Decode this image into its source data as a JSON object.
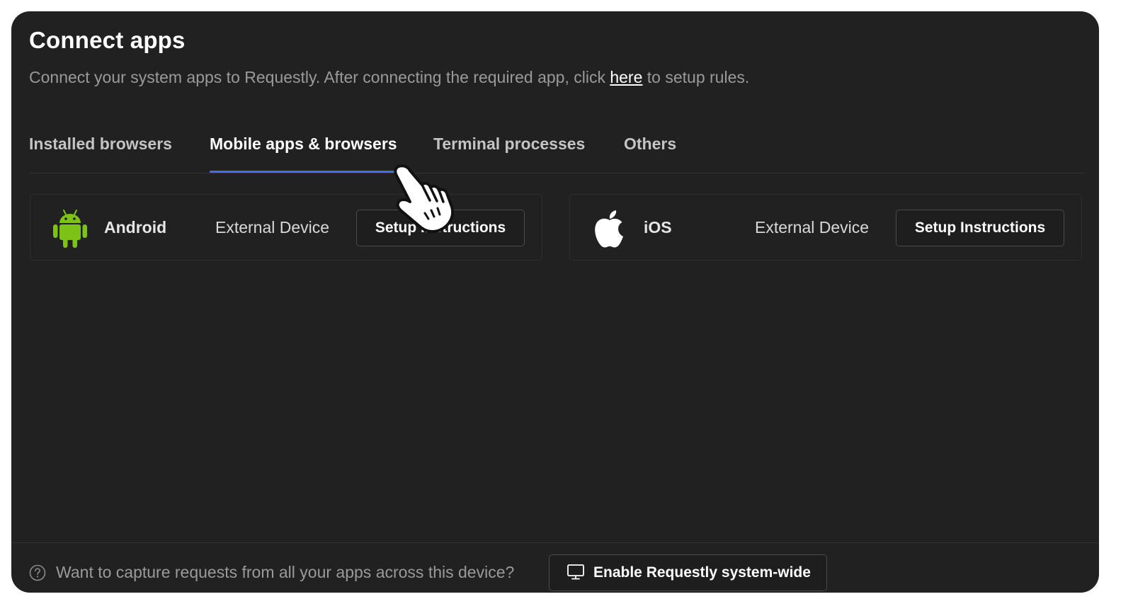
{
  "header": {
    "title": "Connect apps",
    "subtitle_before": "Connect your system apps to Requestly. After connecting the required app, click ",
    "subtitle_link": "here",
    "subtitle_after": " to setup rules."
  },
  "tabs": [
    {
      "label": "Installed browsers",
      "active": false
    },
    {
      "label": "Mobile apps & browsers",
      "active": true
    },
    {
      "label": "Terminal processes",
      "active": false
    },
    {
      "label": "Others",
      "active": false
    }
  ],
  "cards": [
    {
      "name": "Android",
      "device": "External Device",
      "button": "Setup Instructions",
      "icon": "android-icon"
    },
    {
      "name": "iOS",
      "device": "External Device",
      "button": "Setup Instructions",
      "icon": "apple-icon"
    }
  ],
  "footer": {
    "question": "Want to capture requests from all your apps across this device?",
    "button": "Enable Requestly system-wide",
    "icon": "monitor-icon",
    "help_icon": "question-circle-icon"
  },
  "colors": {
    "background": "#212121",
    "accent": "#3e6fe8",
    "android": "#7cc217",
    "muted_text": "#9a9a9a"
  }
}
